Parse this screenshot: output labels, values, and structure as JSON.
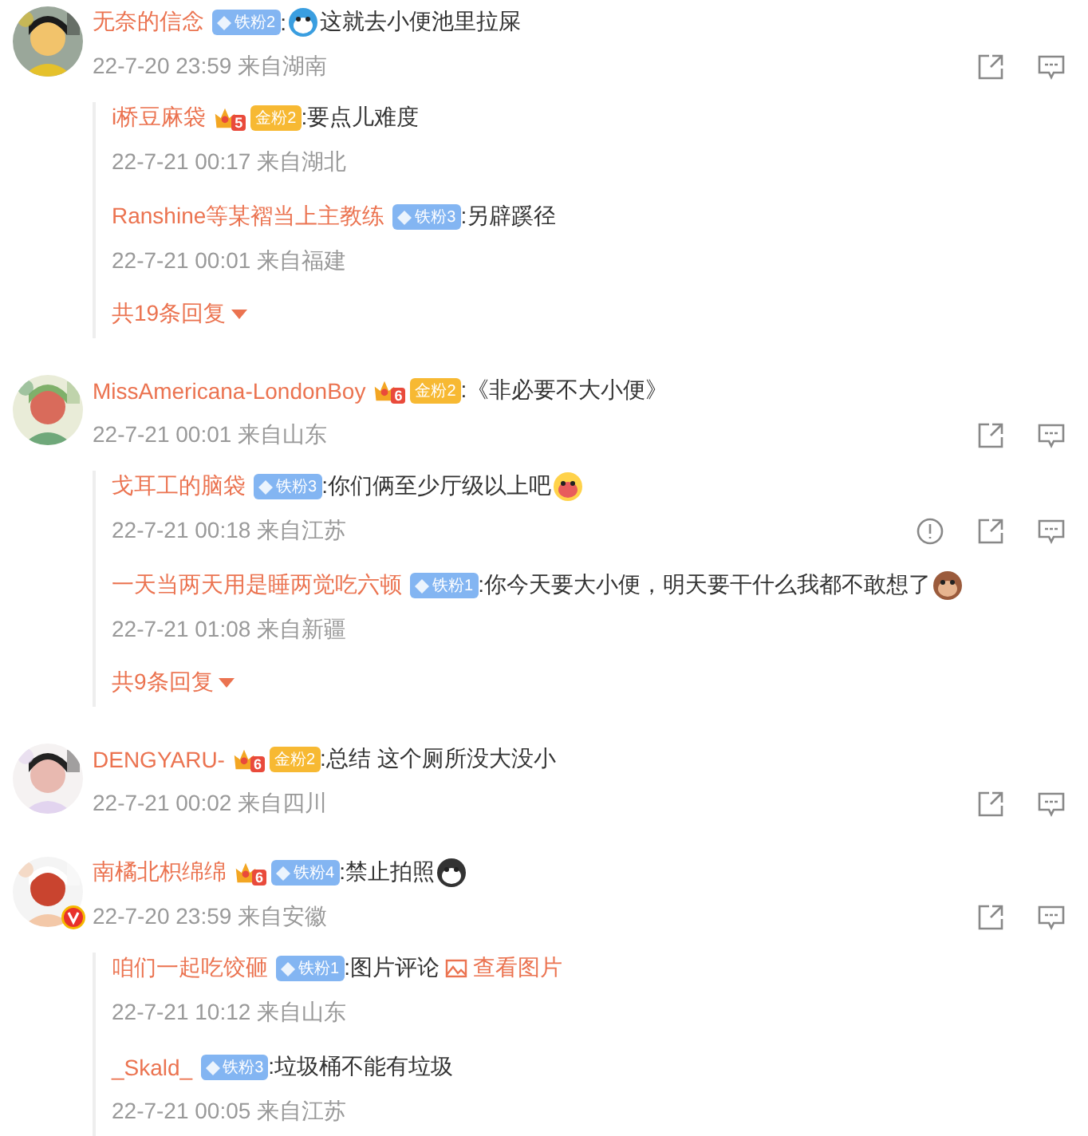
{
  "comments": [
    {
      "verified": false,
      "name": "无奈的信念",
      "badge": {
        "kind": "iron",
        "label": "铁粉2"
      },
      "text": ":",
      "emoji": true,
      "text_after": "这就去小便池里拉屎",
      "time": "22-7-20 23:59 来自湖南",
      "replies": [
        {
          "name": "i桥豆麻袋",
          "badge": {
            "kind": "gold",
            "label": "金粉2",
            "crown": "5"
          },
          "text": ":要点儿难度",
          "time": "22-7-21 00:17 来自湖北",
          "hovered": false
        },
        {
          "name": "Ranshine等某褶当上主教练",
          "badge": {
            "kind": "iron",
            "label": "铁粉3"
          },
          "text": ":另辟蹊径",
          "time": "22-7-21 00:01 来自福建",
          "hovered": false
        }
      ],
      "more_replies": "共19条回复"
    },
    {
      "verified": false,
      "name": "MissAmericana-LondonBoy",
      "badge": {
        "kind": "gold",
        "label": "金粉2",
        "crown": "6"
      },
      "text": ":《非必要不大小便》",
      "time": "22-7-21 00:01 来自山东",
      "replies": [
        {
          "name": "戈耳工的脑袋",
          "badge": {
            "kind": "iron",
            "label": "铁粉3"
          },
          "text": ":你们俩至少厅级以上吧",
          "emoji": true,
          "time": "22-7-21 00:18 来自江苏",
          "hovered": true
        },
        {
          "name": "一天当两天用是睡两觉吃六顿",
          "badge": {
            "kind": "iron",
            "label": "铁粉1"
          },
          "text": ":你今天要大小便，明天要干什么我都不敢想了",
          "emoji": true,
          "time": "22-7-21 01:08 来自新疆",
          "hovered": false
        }
      ],
      "more_replies": "共9条回复"
    },
    {
      "verified": false,
      "name": "DENGYARU-",
      "badge": {
        "kind": "gold",
        "label": "金粉2",
        "crown": "6"
      },
      "text": ":总结 这个厕所没大没小",
      "time": "22-7-21 00:02 来自四川"
    },
    {
      "verified": true,
      "name": "南橘北枳绵绵",
      "badge": {
        "kind": "iron",
        "label": "铁粉4",
        "crown": "6"
      },
      "text": ":禁止拍照",
      "emoji": true,
      "time": "22-7-20 23:59 来自安徽",
      "replies": [
        {
          "name": "咱们一起吃饺砸",
          "badge": {
            "kind": "iron",
            "label": "铁粉1"
          },
          "text": ":图片评论",
          "link": "查看图片",
          "time": "22-7-21 10:12 来自山东",
          "hovered": false
        },
        {
          "name": "_Skald_",
          "badge": {
            "kind": "iron",
            "label": "铁粉3"
          },
          "text": ":垃圾桶不能有垃圾",
          "time": "22-7-21 00:05 来自江苏",
          "hovered": false
        }
      ]
    }
  ]
}
